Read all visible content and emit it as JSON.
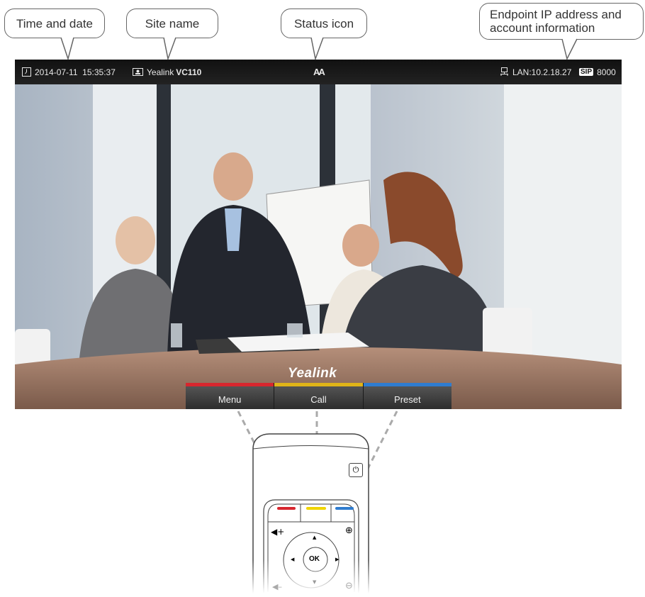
{
  "callouts": {
    "time_date": "Time and date",
    "site_name": "Site name",
    "status_icon": "Status icon",
    "endpoint_info_line1": "Endpoint IP address and",
    "endpoint_info_line2": "account information"
  },
  "status_bar": {
    "datetime": "2014-07-11  15:35:37",
    "site_prefix": "Yealink",
    "site_model": "VC110",
    "status_icon_text": "AA",
    "lan": "LAN:10.2.18.27",
    "sip_badge": "SIP",
    "account": "8000",
    "icons": [
      "clock-icon",
      "monitor-icon",
      "network-icon"
    ]
  },
  "screen": {
    "brand": "Yealink"
  },
  "softkeys": [
    {
      "label": "Menu",
      "color": "#d7262e"
    },
    {
      "label": "Call",
      "color": "#e0b418"
    },
    {
      "label": "Preset",
      "color": "#2f7ccf"
    }
  ],
  "remote": {
    "ok_label": "OK",
    "button_colors": [
      "#d7262e",
      "#f0d400",
      "#2f7ccf"
    ],
    "icons": [
      "power-icon",
      "volume-up-icon",
      "zoom-in-icon",
      "volume-down-icon",
      "zoom-out-icon"
    ]
  }
}
